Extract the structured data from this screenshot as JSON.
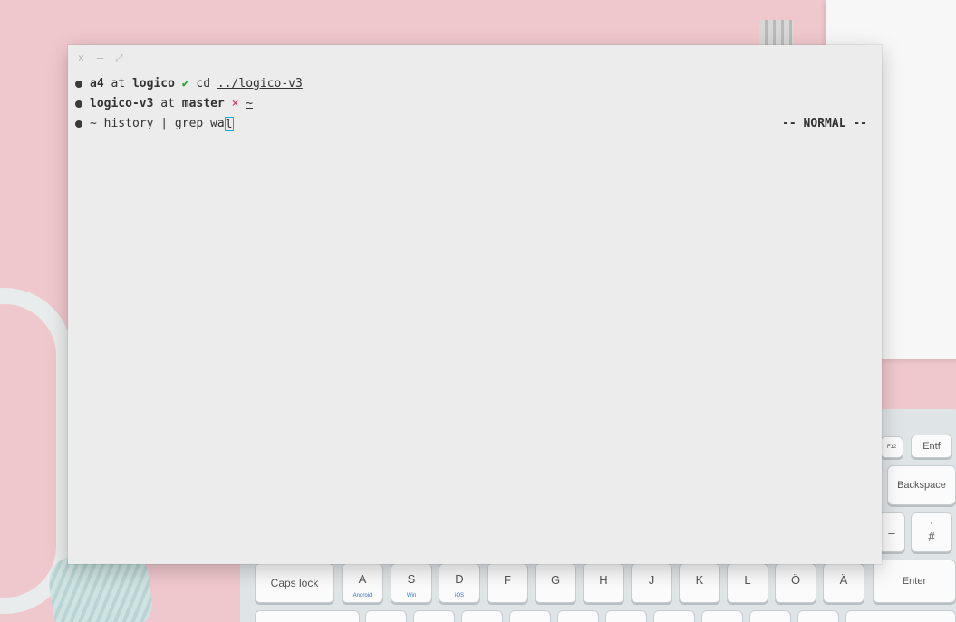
{
  "window": {
    "buttons": {
      "close": "×",
      "minimize": "–",
      "maximize": "⤢"
    }
  },
  "terminal": {
    "lines": [
      {
        "dir": "a4",
        "at": "at",
        "branch": "logico",
        "status_icon": "✔",
        "command": "cd",
        "arg": "../logico-v3"
      },
      {
        "dir": "logico-v3",
        "at": "at",
        "branch": "master",
        "status_icon": "×",
        "arg": "~"
      },
      {
        "dir": "~",
        "command_before_cursor": "history | grep wa",
        "cursor_char": "l"
      }
    ],
    "mode": "-- NORMAL --"
  },
  "colors": {
    "ok": "#21a52c",
    "error": "#d82f5b",
    "cursor": "#17a7d6"
  },
  "keyboard": {
    "keys": {
      "f12": "F12",
      "entf": "Entf",
      "backspace": "Backspace",
      "hash_top": "'",
      "hash": "#",
      "dash": "–",
      "caps": "Caps lock",
      "a": "A",
      "a_sub": "Android",
      "s": "S",
      "s_sub": "Win",
      "d": "D",
      "d_sub": "iOS",
      "f": "F",
      "g": "G",
      "h": "H",
      "j": "J",
      "k": "K",
      "l": "L",
      "oe": "Ö",
      "ae": "Ä",
      "enter": "Enter"
    }
  }
}
